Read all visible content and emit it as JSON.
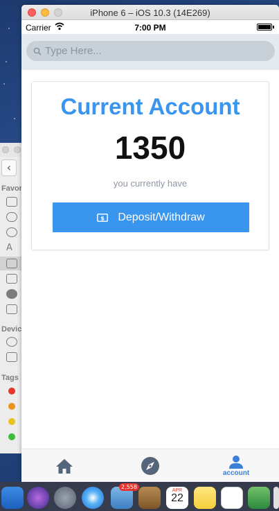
{
  "window": {
    "title": "iPhone 6 – iOS 10.3 (14E269)"
  },
  "status_bar": {
    "carrier": "Carrier",
    "time": "7:00 PM"
  },
  "search": {
    "placeholder": "Type Here..."
  },
  "account_card": {
    "title": "Current Account",
    "balance": "1350",
    "caption": "you currently have",
    "button_label": "Deposit/Withdraw"
  },
  "tab_bar": {
    "tabs": [
      {
        "icon": "home-icon",
        "label": ""
      },
      {
        "icon": "compass-icon",
        "label": ""
      },
      {
        "icon": "person-icon",
        "label": "account"
      }
    ],
    "active_color": "#3a7fd8"
  },
  "finder_sidebar": {
    "sections": [
      "Favor",
      "Devic",
      "Tags"
    ],
    "tag_colors": [
      "#e8352b",
      "#f0911f",
      "#e8c21f",
      "#3bbf3b"
    ]
  },
  "dock": {
    "mail_badge": "2,558",
    "calendar_month": "APR",
    "calendar_day": "22"
  },
  "colors": {
    "accent": "#3a95ee",
    "search_bg": "#e4eaf0"
  }
}
